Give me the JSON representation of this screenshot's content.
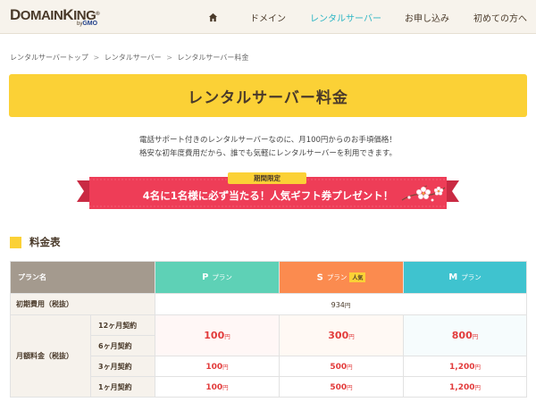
{
  "header": {
    "logo": {
      "main_pre": "D",
      "main_rest_1": "OMAIN",
      "main_k": "K",
      "main_rest_2": "ING",
      "reg": "®",
      "sub_by": "by",
      "sub_brand": "GMO"
    },
    "nav": [
      {
        "label": "",
        "icon": "home-icon"
      },
      {
        "label": "ドメイン"
      },
      {
        "label": "レンタルサーバー",
        "active": true
      },
      {
        "label": "お申し込み"
      },
      {
        "label": "初めての方へ"
      }
    ],
    "accent_color": "#2bb5c4"
  },
  "breadcrumb": [
    "レンタルサーバートップ",
    "レンタルサーバー",
    "レンタルサーバー料金"
  ],
  "breadcrumb_sep": ">",
  "page_title": "レンタルサーバー料金",
  "intro": {
    "line1": "電話サポート付きのレンタルサーバーなのに、月100円からのお手頃価格！",
    "line2": "格安な初年度費用だから、誰でも気軽にレンタルサーバーを利用できます。"
  },
  "campaign": {
    "badge": "期間限定",
    "text": "4名に1名様に必ず当たる！人気ギフト券プレゼント！",
    "ribbon_color": "#ee3d57",
    "badge_color": "#fbd136"
  },
  "section": {
    "title": "料金表"
  },
  "table": {
    "header": {
      "plan_label": "プラン名",
      "suffix": "プラン",
      "popular": "人気"
    },
    "plans": [
      {
        "letter": "P",
        "color": "#5ed1b6"
      },
      {
        "letter": "S",
        "color": "#fb8b4f"
      },
      {
        "letter": "M",
        "color": "#3fc3cf"
      }
    ],
    "initial": {
      "label": "初期費用（税抜）",
      "value": "934",
      "unit": "円"
    },
    "monthly": {
      "label": "月額料金（税抜）",
      "unit": "円",
      "rows": [
        {
          "term": "12ヶ月契約"
        },
        {
          "term": "6ヶ月契約"
        },
        {
          "term": "3ヶ月契約",
          "values": [
            "100",
            "500",
            "1,200"
          ]
        },
        {
          "term": "1ヶ月契約",
          "values": [
            "100",
            "500",
            "1,200"
          ]
        }
      ],
      "long_term_values": [
        "100",
        "300",
        "800"
      ]
    }
  }
}
